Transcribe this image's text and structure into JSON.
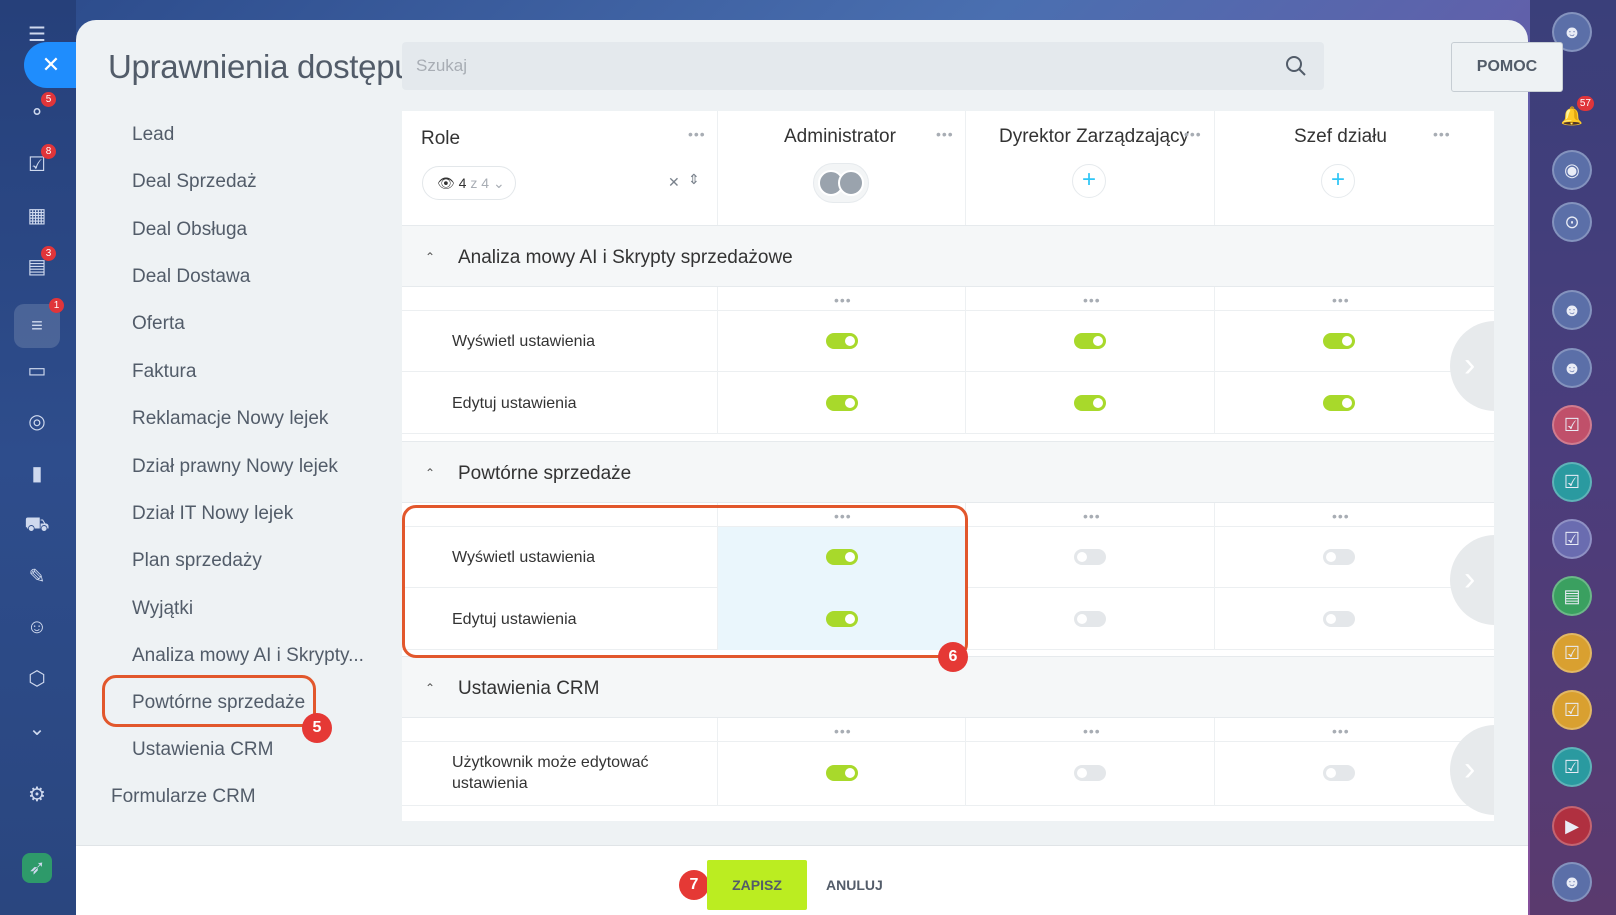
{
  "colors": {
    "accent_blue": "#1f8dfd",
    "toggle_on": "#a8d92b",
    "save_button": "#bbed21",
    "callout": "#e2572c",
    "badge": "#e53935"
  },
  "left_rail": {
    "close_icon": "close-icon",
    "badges": {
      "sales": "5",
      "tasks": "8",
      "contacts": "3",
      "funnel": "1"
    }
  },
  "right_rail": {
    "notifications_badge": "57"
  },
  "header": {
    "title": "Uprawnienia dostępu",
    "search_placeholder": "Szukaj",
    "help_label": "POMOC"
  },
  "sidebar": {
    "items": [
      "Lead",
      "Deal Sprzedaż",
      "Deal Obsługa",
      "Deal Dostawa",
      "Oferta",
      "Faktura",
      "Reklamacje Nowy lejek",
      "Dział prawny Nowy lejek",
      "Dział IT Nowy lejek",
      "Plan sprzedaży",
      "Wyjątki",
      "Analiza mowy AI i Skrypty...",
      "Powtórne sprzedaże",
      "Ustawienia CRM"
    ],
    "top_item": "Formularze CRM"
  },
  "table": {
    "roles_header": "Role",
    "role_filter": {
      "selected": "4",
      "total": "z 4"
    },
    "columns": [
      "Administrator",
      "Dyrektor Zarządzający",
      "Szef działu"
    ],
    "sections": [
      {
        "title": "Analiza mowy AI i Skrypty sprzedażowe",
        "rows": [
          {
            "label": "Wyświetl ustawienia",
            "values": [
              true,
              true,
              true
            ]
          },
          {
            "label": "Edytuj ustawienia",
            "values": [
              true,
              true,
              true
            ]
          }
        ]
      },
      {
        "title": "Powtórne sprzedaże",
        "rows": [
          {
            "label": "Wyświetl ustawienia",
            "values": [
              true,
              false,
              false
            ]
          },
          {
            "label": "Edytuj ustawienia",
            "values": [
              true,
              false,
              false
            ]
          }
        ]
      },
      {
        "title": "Ustawienia CRM",
        "rows": [
          {
            "label": "Użytkownik może edytować ustawienia",
            "values": [
              true,
              false,
              false
            ]
          }
        ]
      }
    ]
  },
  "callouts": {
    "sidebar": "5",
    "table": "6",
    "save": "7"
  },
  "footer": {
    "save_label": "ZAPISZ",
    "cancel_label": "ANULUJ"
  }
}
